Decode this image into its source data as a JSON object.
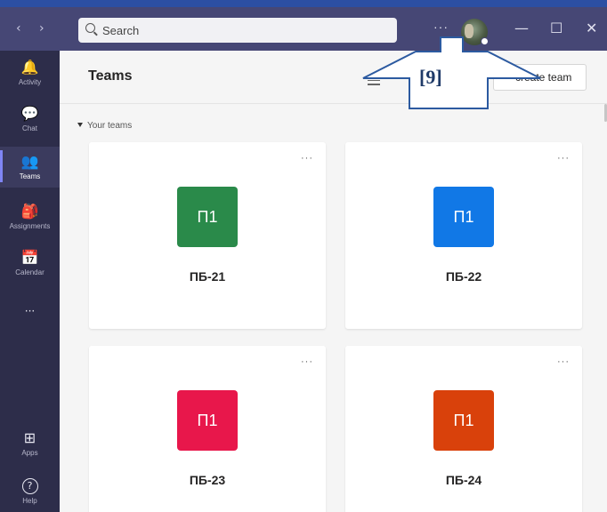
{
  "titlebar": {
    "back_glyph": "‹",
    "forward_glyph": "›",
    "search_placeholder": "Search",
    "more_glyph": "···",
    "avatar_icon": "user-avatar",
    "minimize_glyph": "—",
    "maximize_glyph": "☐",
    "close_glyph": "✕"
  },
  "rail": {
    "items": [
      {
        "label": "Activity",
        "icon": "bell-icon",
        "glyph": "🔔"
      },
      {
        "label": "Chat",
        "icon": "chat-icon",
        "glyph": "💬"
      },
      {
        "label": "Teams",
        "icon": "teams-icon",
        "glyph": "👥",
        "active": true
      },
      {
        "label": "Assignments",
        "icon": "assignments-icon",
        "glyph": "🎒"
      },
      {
        "label": "Calendar",
        "icon": "calendar-icon",
        "glyph": "📅"
      }
    ],
    "more_glyph": "···",
    "apps_label": "Apps",
    "apps_glyph": "⊞",
    "help_label": "Help",
    "help_glyph": "?"
  },
  "main": {
    "title": "Teams",
    "create_team_label": "create team",
    "section_label": "Your teams",
    "teams": [
      {
        "initials": "П1",
        "name": "ПБ-21",
        "color": "#2a8a4a"
      },
      {
        "initials": "П1",
        "name": "ПБ-22",
        "color": "#1178e6"
      },
      {
        "initials": "П1",
        "name": "ПБ-23",
        "color": "#e8174b"
      },
      {
        "initials": "П1",
        "name": "ПБ-24",
        "color": "#d9410b"
      }
    ],
    "card_more_glyph": "···"
  },
  "annotation": {
    "label": "[9]",
    "color": "#2c5aa0"
  },
  "colors": {
    "titlebar": "#464775",
    "rail": "#2d2d4a",
    "accent": "#7f85f5"
  }
}
